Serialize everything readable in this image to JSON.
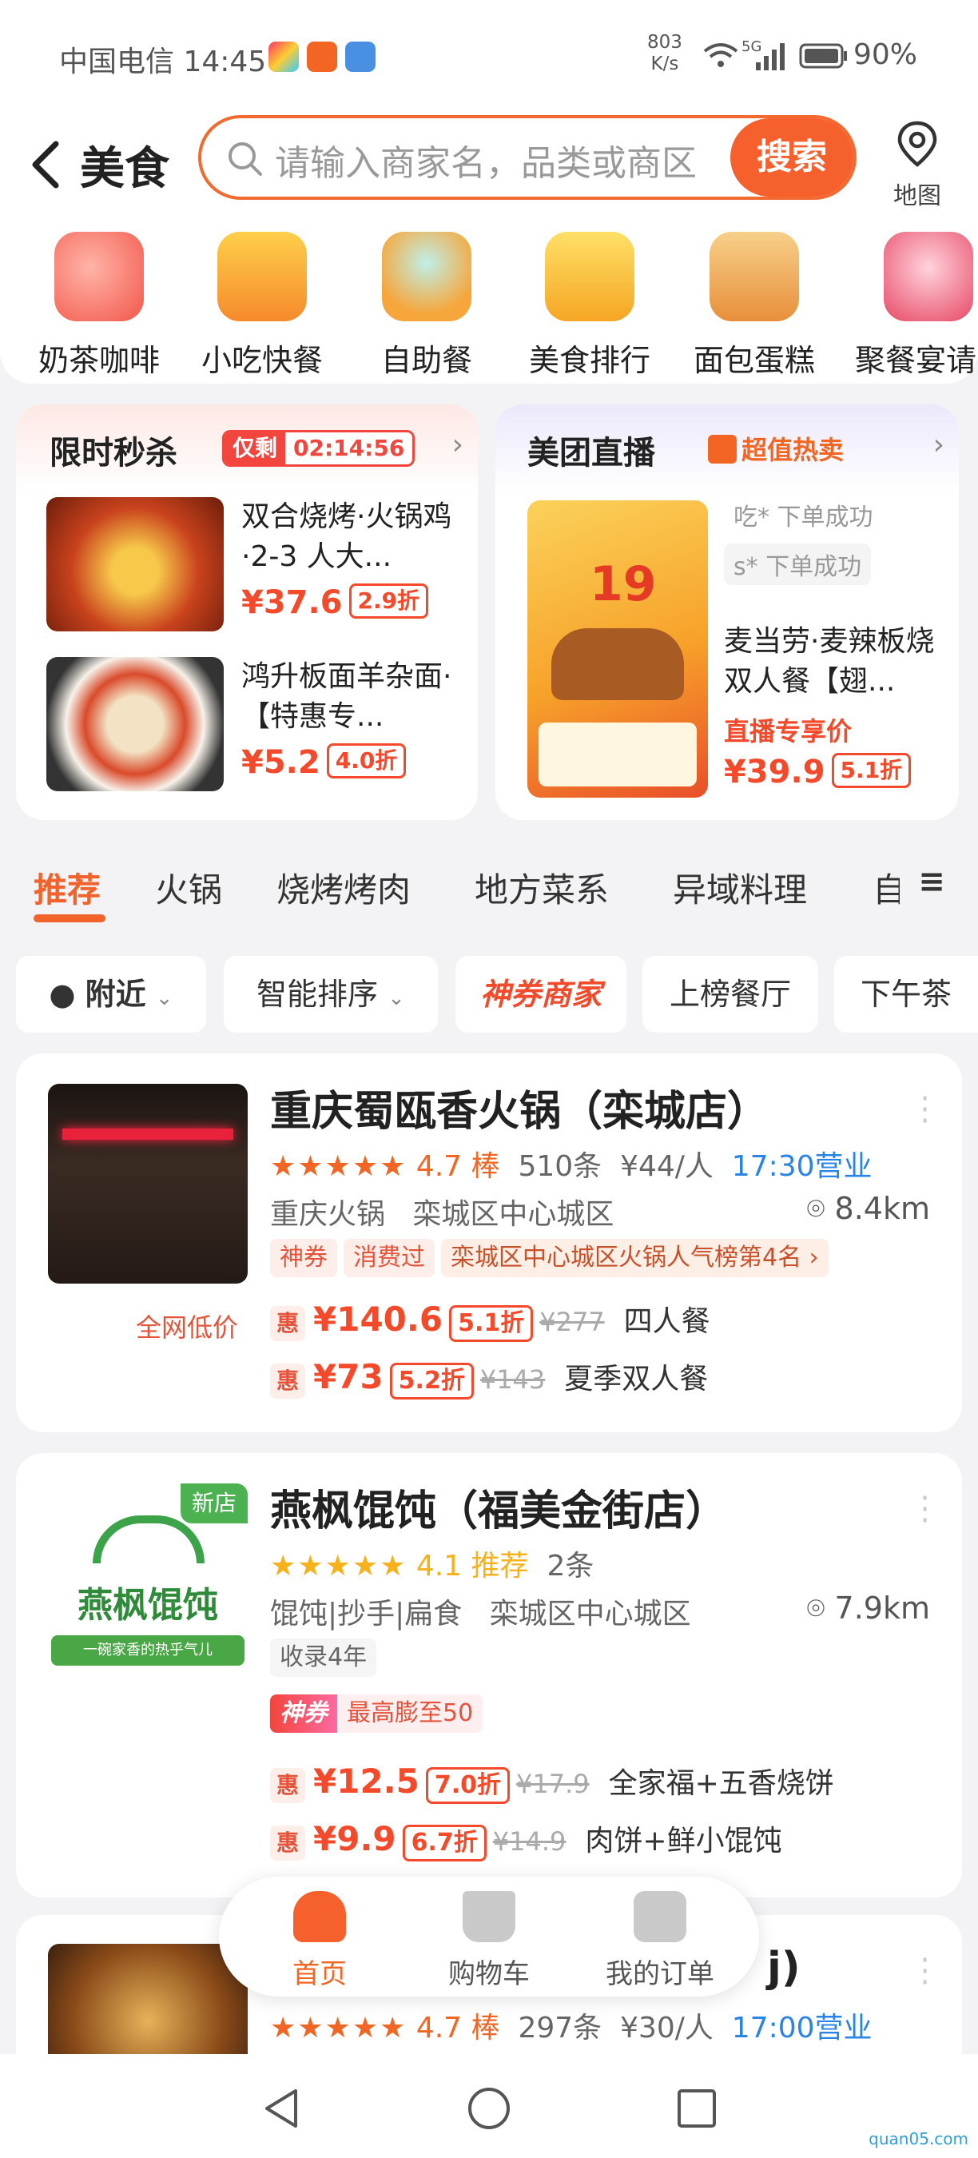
{
  "status_bar": {
    "carrier_time": "中国电信 14:45",
    "speed": "803",
    "speed_unit": "K/s",
    "network": "5G",
    "battery": "90%"
  },
  "header": {
    "title": "美食",
    "search_placeholder": "请输入商家名，品类或商区",
    "search_button": "搜索",
    "map_label": "地图"
  },
  "categories": [
    {
      "label": "奶茶咖啡",
      "icon": "milk-tea-icon"
    },
    {
      "label": "小吃快餐",
      "icon": "fries-burger-icon"
    },
    {
      "label": "自助餐",
      "icon": "buffet-bowl-icon"
    },
    {
      "label": "美食排行",
      "icon": "trophy-icon"
    },
    {
      "label": "面包蛋糕",
      "icon": "bread-cake-icon"
    },
    {
      "label": "聚餐宴请",
      "icon": "wine-glasses-icon"
    }
  ],
  "flash_sale": {
    "title": "限时秒杀",
    "badge_label": "仅剩",
    "countdown": "02:14:56",
    "deals": [
      {
        "name": "双合烧烤·火锅鸡·2-3 人大...",
        "price": "¥37.6",
        "discount": "2.9折"
      },
      {
        "name": "鸿升板面羊杂面·【特惠专...",
        "price": "¥5.2",
        "discount": "4.0折"
      }
    ]
  },
  "live": {
    "title": "美团直播",
    "tag": "超值热卖",
    "tickers": [
      "吃* 下单成功",
      "s* 下单成功"
    ],
    "deal_name": "麦当劳·麦辣板烧双人餐【翅...",
    "deal_tag": "直播专享价",
    "price": "¥39.9",
    "discount": "5.1折",
    "poster_number": "19"
  },
  "tabs": [
    "推荐",
    "火锅",
    "烧烤烤肉",
    "地方菜系",
    "异域料理",
    "自"
  ],
  "filters": {
    "nearby": "附近",
    "sort": "智能排序",
    "coupon": "神券商家",
    "ranked": "上榜餐厅",
    "tea": "下午茶"
  },
  "stores": [
    {
      "name": "重庆蜀瓯香火锅（栾城店）",
      "stars": "★★★★★",
      "rating": "4.7",
      "rating_tag": "棒",
      "reviews": "510条",
      "per_person": "¥44/人",
      "open_time": "17:30营业",
      "category": "重庆火锅",
      "area": "栾城区中心城区",
      "distance": "8.4km",
      "tags": [
        "神券",
        "消费过"
      ],
      "rank": "栾城区中心城区火锅人气榜第4名",
      "low_price_label": "全网低价",
      "deals": [
        {
          "badge": "惠",
          "price": "¥140.6",
          "discount": "5.1折",
          "original": "¥277",
          "name": "四人餐"
        },
        {
          "badge": "惠",
          "price": "¥73",
          "discount": "5.2折",
          "original": "¥143",
          "name": "夏季双人餐"
        }
      ]
    },
    {
      "name": "燕枫馄饨（福美金街店）",
      "new_badge": "新店",
      "logo_text": "燕枫馄饨",
      "logo_slogan": "一碗家香的热乎气儿",
      "stars": "★★★★★",
      "rating": "4.1",
      "rating_tag": "推荐",
      "reviews": "2条",
      "category": "馄饨|抄手|扁食",
      "area": "栾城区中心城区",
      "distance": "7.9km",
      "years_tag": "收录4年",
      "coupon_label": "神券",
      "coupon_text": "最高膨至50",
      "deals": [
        {
          "badge": "惠",
          "price": "¥12.5",
          "discount": "7.0折",
          "original": "¥17.9",
          "name": "全家福+五香烧饼"
        },
        {
          "badge": "惠",
          "price": "¥9.9",
          "discount": "6.7折",
          "original": "¥14.9",
          "name": "肉饼+鲜小馄饨"
        }
      ]
    },
    {
      "name_tail": "j)",
      "stars": "★★★★★",
      "rating": "4.7",
      "rating_tag": "棒",
      "reviews": "297条",
      "per_person": "¥30/人",
      "open_time": "17:00营业"
    }
  ],
  "bottom_nav": [
    {
      "label": "首页",
      "icon": "home-icon"
    },
    {
      "label": "购物车",
      "icon": "cart-icon"
    },
    {
      "label": "我的订单",
      "icon": "orders-icon"
    }
  ],
  "watermark": "quan05.com",
  "colors": {
    "accent": "#f5602d",
    "price": "#f24a2b",
    "link": "#2a84e6"
  }
}
